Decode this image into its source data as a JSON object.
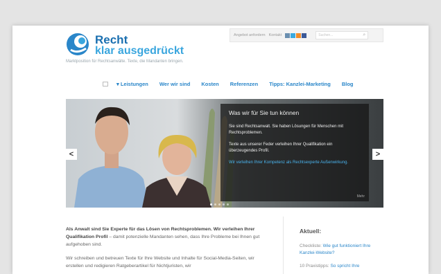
{
  "brand": {
    "name_line1": "Recht",
    "name_line2": "klar ausgedrückt",
    "tagline": "Marktposition für Rechtsanwälte. Texte, die Mandanten bringen."
  },
  "utility": {
    "link_offer": "Angebot anfordern",
    "link_contact": "Kontakt",
    "search_placeholder": "Suchen...",
    "social_icons": [
      "newsletter-icon",
      "twitter-icon",
      "rss-icon",
      "facebook-icon"
    ],
    "social_colors": [
      "#6a8fb0",
      "#39a9e0",
      "#f28c28",
      "#3b5998"
    ]
  },
  "nav": {
    "items": [
      "▾ Leistungen",
      "Wer wir sind",
      "Kosten",
      "Referenzen",
      "Tipps: Kanzlei-Marketing",
      "Blog"
    ]
  },
  "slider": {
    "title": "Was wir für Sie tun können",
    "p1": "Sie sind Rechtsanwalt. Sie haben Lösungen für Menschen mit Rechtsproblemen.",
    "p2": "Texte aus unserer Feder verleihen Ihrer Qualifikation ein überzeugendes Profil.",
    "link": "Wir verleihen Ihrer Kompetenz als Rechtsexperte Außenwirkung.",
    "more": "Mehr",
    "prev": "<",
    "next": ">",
    "dot_count": 5,
    "active_dot": 0
  },
  "content": {
    "lead_bold": "Als Anwalt sind Sie Experte für das Lösen von Rechtsproblemen. Wir verleihen Ihrer Qualifikation Profil",
    "lead_rest": " – damit potenzielle Mandanten sehen, dass Ihre Probleme bei Ihnen gut aufgehoben sind.",
    "p2": "Wir schreiben und betreuen Texte für Ihre Website und Inhalte für Social-Media-Seiten, wir erstellen und redigieren Ratgeberartikel für Nichtjuristen, wir"
  },
  "sidebar": {
    "heading": "Aktuell:",
    "item1_prefix": "Checkliste: ",
    "item1_link": "Wie gut funktioniert Ihre Kanzlei-Website?",
    "item2_prefix": "10 Praxistipps: ",
    "item2_link": "So spricht Ihre"
  }
}
